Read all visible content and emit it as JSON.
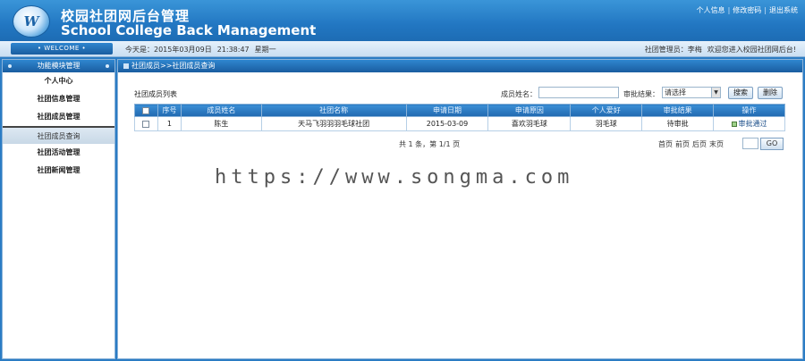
{
  "header": {
    "logo_text": "W",
    "title_cn": "校园社团网后台管理",
    "title_en": "School College Back Management",
    "links": [
      "个人信息",
      "修改密码",
      "退出系统"
    ],
    "separator": "|"
  },
  "infobar": {
    "welcome": "• WELCOME •",
    "date": "今天是：2015年03月09日",
    "time": "21:38:47",
    "weekday": "星期一",
    "admin": "社团管理员：李梅",
    "greeting": "欢迎您进入校园社团网后台!"
  },
  "sidebar": {
    "title": "功能模块管理",
    "items": [
      "个人中心",
      "社团信息管理",
      "社团成员管理",
      "社团成员查询",
      "社团活动管理",
      "社团新闻管理"
    ]
  },
  "main": {
    "breadcrumb": "社团成员>>社团成员查询",
    "list_title": "社团成员列表",
    "filter": {
      "name_label": "成员姓名：",
      "status_label": "审批结果：",
      "status_selected": "请选择",
      "search_btn": "搜索",
      "delete_btn": "删除"
    },
    "table": {
      "headers": [
        "",
        "序号",
        "成员姓名",
        "社团名称",
        "申请日期",
        "申请原因",
        "个人爱好",
        "审批结果",
        "操作"
      ],
      "rows": [
        [
          "",
          "1",
          "陈生",
          "天马飞羽羽羽毛球社团",
          "2015-03-09",
          "喜欢羽毛球",
          "羽毛球",
          "待审批",
          "审批通过"
        ]
      ]
    },
    "pager": {
      "info": "共 1 条，第 1/1 页",
      "links": [
        "首页",
        "前页",
        "后页",
        "末页"
      ],
      "go": "GO"
    }
  },
  "watermark": "https://www.songma.com",
  "colors": {
    "header_blue": "#2277c2",
    "panel_blue": "#1a5da0"
  }
}
